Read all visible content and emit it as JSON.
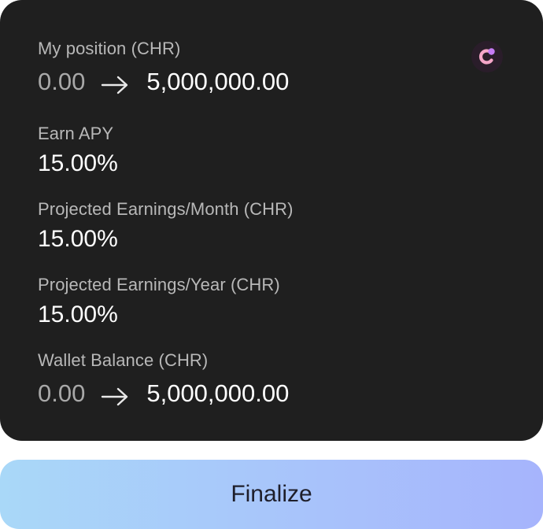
{
  "position": {
    "label": "My position (CHR)",
    "from": "0.00",
    "to": "5,000,000.00"
  },
  "earn_apy": {
    "label": "Earn APY",
    "value": "15.00%"
  },
  "projected_month": {
    "label": "Projected Earnings/Month (CHR)",
    "value": "15.00%"
  },
  "projected_year": {
    "label": "Projected Earnings/Year (CHR)",
    "value": "15.00%"
  },
  "wallet_balance": {
    "label": "Wallet Balance (CHR)",
    "from": "0.00",
    "to": "5,000,000.00"
  },
  "finalize_label": "Finalize",
  "icons": {
    "logo": "chromia-logo-icon",
    "arrow": "arrow-right-icon"
  },
  "colors": {
    "card_bg": "#1f1f1f",
    "logo_pink": "#f5a6c8",
    "logo_purple": "#c67cf5",
    "button_gradient_start": "#a9d8f8",
    "button_gradient_end": "#a6b4fc"
  }
}
